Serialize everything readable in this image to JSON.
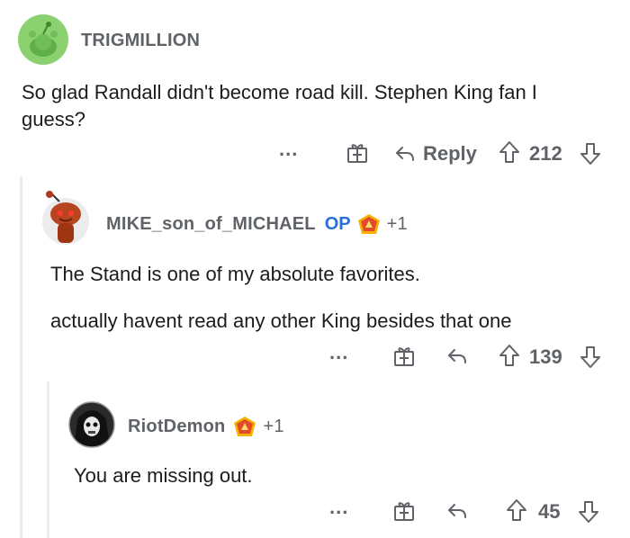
{
  "comment1": {
    "username": "TRIGMILLION",
    "text": "So glad Randall didn't become road kill. Stephen King fan I guess?",
    "more": "...",
    "reply_label": "Reply",
    "votes": "212"
  },
  "comment2": {
    "username": "MIKE_son_of_MICHAEL",
    "op_tag": "OP",
    "award_count": "+1",
    "text1": "The Stand is one of my absolute favorites.",
    "text2": "actually havent read any other King besides that one",
    "more": "...",
    "votes": "139"
  },
  "comment3": {
    "username": "RiotDemon",
    "award_count": "+1",
    "text": "You are missing out.",
    "more": "...",
    "votes": "45"
  },
  "colors": {
    "avatar_green": "#8bd16f",
    "op_blue": "#2a6fd6",
    "muted": "#5f6368"
  }
}
